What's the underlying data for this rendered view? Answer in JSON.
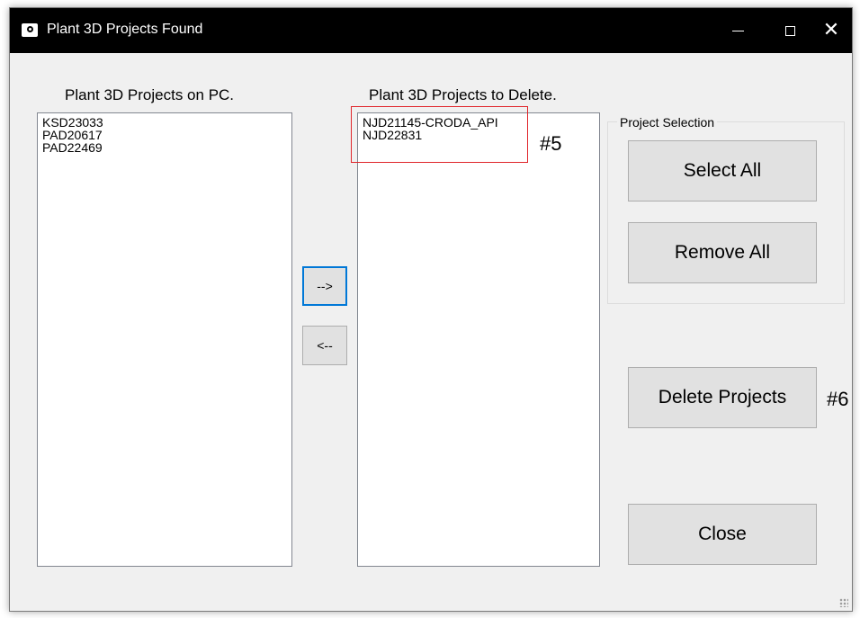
{
  "window": {
    "title": "Plant 3D Projects Found"
  },
  "left_list": {
    "label": "Plant 3D Projects on PC.",
    "items": [
      "KSD23033",
      "PAD20617",
      "PAD22469"
    ]
  },
  "right_list": {
    "label": "Plant 3D Projects to Delete.",
    "items": [
      "NJD21145-CRODA_API",
      "NJD22831"
    ]
  },
  "transfer": {
    "add_label": "-->",
    "remove_label": "<--"
  },
  "project_selection": {
    "legend": "Project Selection",
    "select_all_label": "Select All",
    "remove_all_label": "Remove All"
  },
  "actions": {
    "delete_label": "Delete Projects",
    "close_label": "Close"
  },
  "annotations": {
    "step5": "#5",
    "step6": "#6"
  },
  "colors": {
    "titlebar": "#000000",
    "window_bg": "#f0f0f0",
    "button_bg": "#e1e1e1",
    "focus_border": "#0078d7",
    "highlight_box": "#e0262b"
  }
}
